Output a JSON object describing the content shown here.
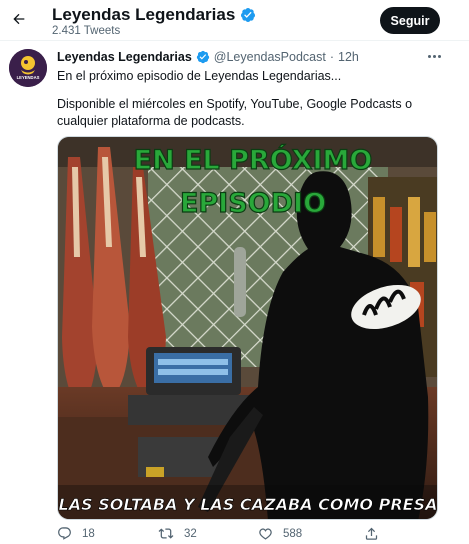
{
  "header": {
    "title": "Leyendas Legendarias",
    "tweet_count": "2.431 Tweets",
    "follow_label": "Seguir",
    "back_icon": "arrow-left-icon",
    "verified_icon": "verified-badge-icon"
  },
  "tweet": {
    "author_name": "Leyendas Legendarias",
    "handle": "@LeyendasPodcast",
    "separator": "·",
    "time": "12h",
    "text_line1": "En el próximo episodio de Leyendas Legendarias...",
    "text_line2": "Disponible el miércoles en Spotify, YouTube, Google Podcasts o cualquier plataforma de podcasts.",
    "avatar_text": "LEYENDAS",
    "media": {
      "headline_line1": "EN EL PRÓXIMO",
      "headline_line2": "EPISODIO",
      "caption": "\"LAS SOLTABA Y LAS CAZABA COMO PRESA\""
    }
  },
  "actions": {
    "reply_count": "18",
    "retweet_count": "32",
    "like_count": "588"
  },
  "colors": {
    "accent": "#1d9bf0",
    "follow_bg": "#0f1419",
    "secondary_text": "#536471",
    "headline_green": "#29a83a",
    "avatar_bg": "#3a1f4a",
    "avatar_logo": "#f4c430"
  }
}
